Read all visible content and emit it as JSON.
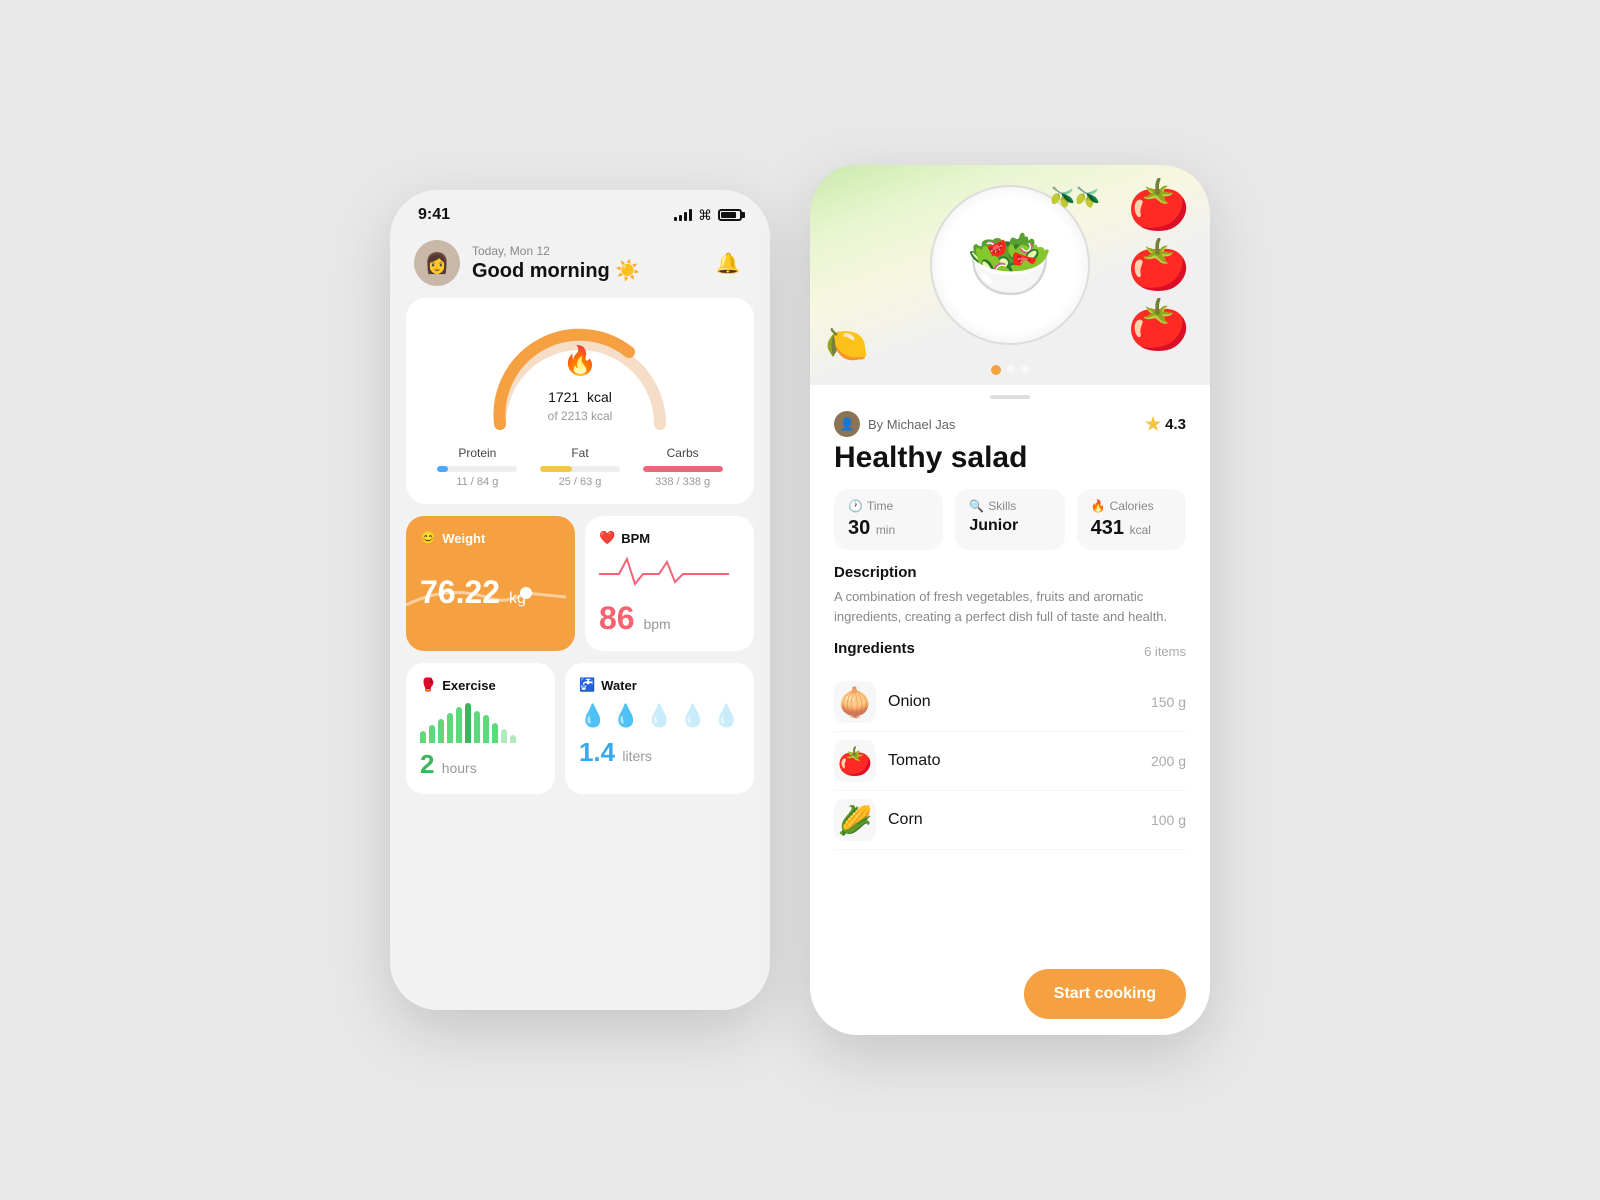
{
  "left_phone": {
    "status": {
      "time": "9:41"
    },
    "header": {
      "date": "Today, Mon 12",
      "greeting": "Good morning ☀️",
      "avatar_emoji": "👩"
    },
    "calories": {
      "current": "1721",
      "unit": "kcal",
      "of_label": "of 2213 kcal",
      "flame": "🔥",
      "progress": 0.78
    },
    "macros": [
      {
        "label": "Protein",
        "value": "11 / 84 g",
        "percent": 0.13,
        "color": "#4da6ff"
      },
      {
        "label": "Fat",
        "value": "25 / 63 g",
        "percent": 0.4,
        "color": "#f5c842"
      },
      {
        "label": "Carbs",
        "value": "338 / 338 g",
        "percent": 1.0,
        "color": "#f5637a"
      }
    ],
    "weight": {
      "label": "Weight",
      "emoji": "😊",
      "value": "76.22",
      "unit": "kg"
    },
    "bpm": {
      "label": "BPM",
      "emoji": "❤️",
      "value": "86",
      "unit": "bpm"
    },
    "exercise": {
      "label": "Exercise",
      "emoji": "🥊",
      "value": "2",
      "unit": "hours"
    },
    "water": {
      "label": "Water",
      "emoji": "🚰",
      "value": "1.4",
      "unit": "liters",
      "filled": 2,
      "total": 5
    }
  },
  "right_phone": {
    "author": "By Michael Jas",
    "rating": "4.3",
    "title": "Healthy salad",
    "stats": [
      {
        "icon": "🕐",
        "label": "Time",
        "value": "30",
        "unit": "min"
      },
      {
        "icon": "🔍",
        "label": "Skills",
        "value": "Junior",
        "unit": ""
      },
      {
        "icon": "🔥",
        "label": "Calories",
        "value": "431",
        "unit": "kcal"
      }
    ],
    "description_title": "Description",
    "description": "A combination of fresh vegetables, fruits and aromatic ingredients, creating a perfect dish full of taste and health.",
    "ingredients_title": "Ingredients",
    "ingredients_count": "6 items",
    "ingredients": [
      {
        "emoji": "🧅",
        "name": "Onion",
        "amount": "150 g"
      },
      {
        "emoji": "🍅",
        "name": "Tomato",
        "amount": "200 g"
      },
      {
        "emoji": "🌽",
        "name": "Corn",
        "amount": "100 g"
      }
    ],
    "start_cooking": "Start cooking",
    "dots": [
      "active",
      "inactive",
      "inactive"
    ]
  }
}
